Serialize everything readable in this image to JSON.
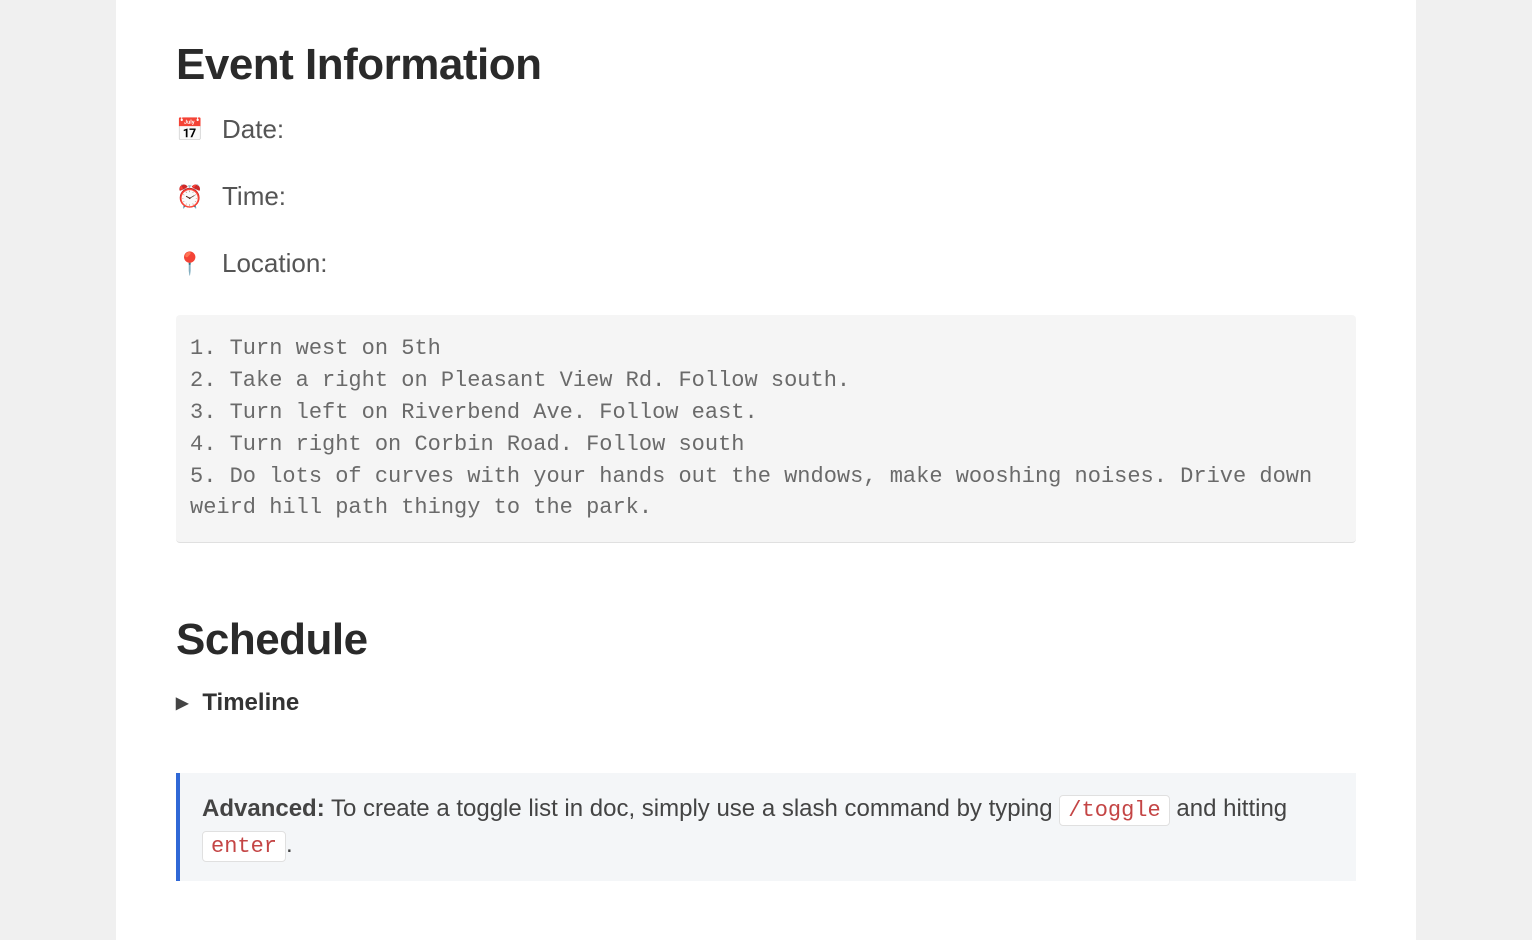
{
  "event_info": {
    "heading": "Event Information",
    "fields": {
      "date_icon": "📅",
      "date_label": "Date:",
      "time_icon": "⏰",
      "time_label": "Time:",
      "location_icon": "📍",
      "location_label": "Location:"
    },
    "directions": [
      "Turn west on 5th",
      "Take a right on Pleasant View Rd. Follow south.",
      "Turn left on Riverbend Ave. Follow east.",
      "Turn right on Corbin Road. Follow south",
      "Do lots of curves with your hands out the wndows, make wooshing noises. Drive down weird hill path thingy to the park."
    ]
  },
  "schedule": {
    "heading": "Schedule",
    "toggle_label": "Timeline"
  },
  "callout": {
    "strong": "Advanced:",
    "text_before": " To create a toggle list in doc, simply use a slash command by typing ",
    "kbd1": "/toggle",
    "text_mid": " and hitting ",
    "kbd2": "enter",
    "text_after": "."
  }
}
